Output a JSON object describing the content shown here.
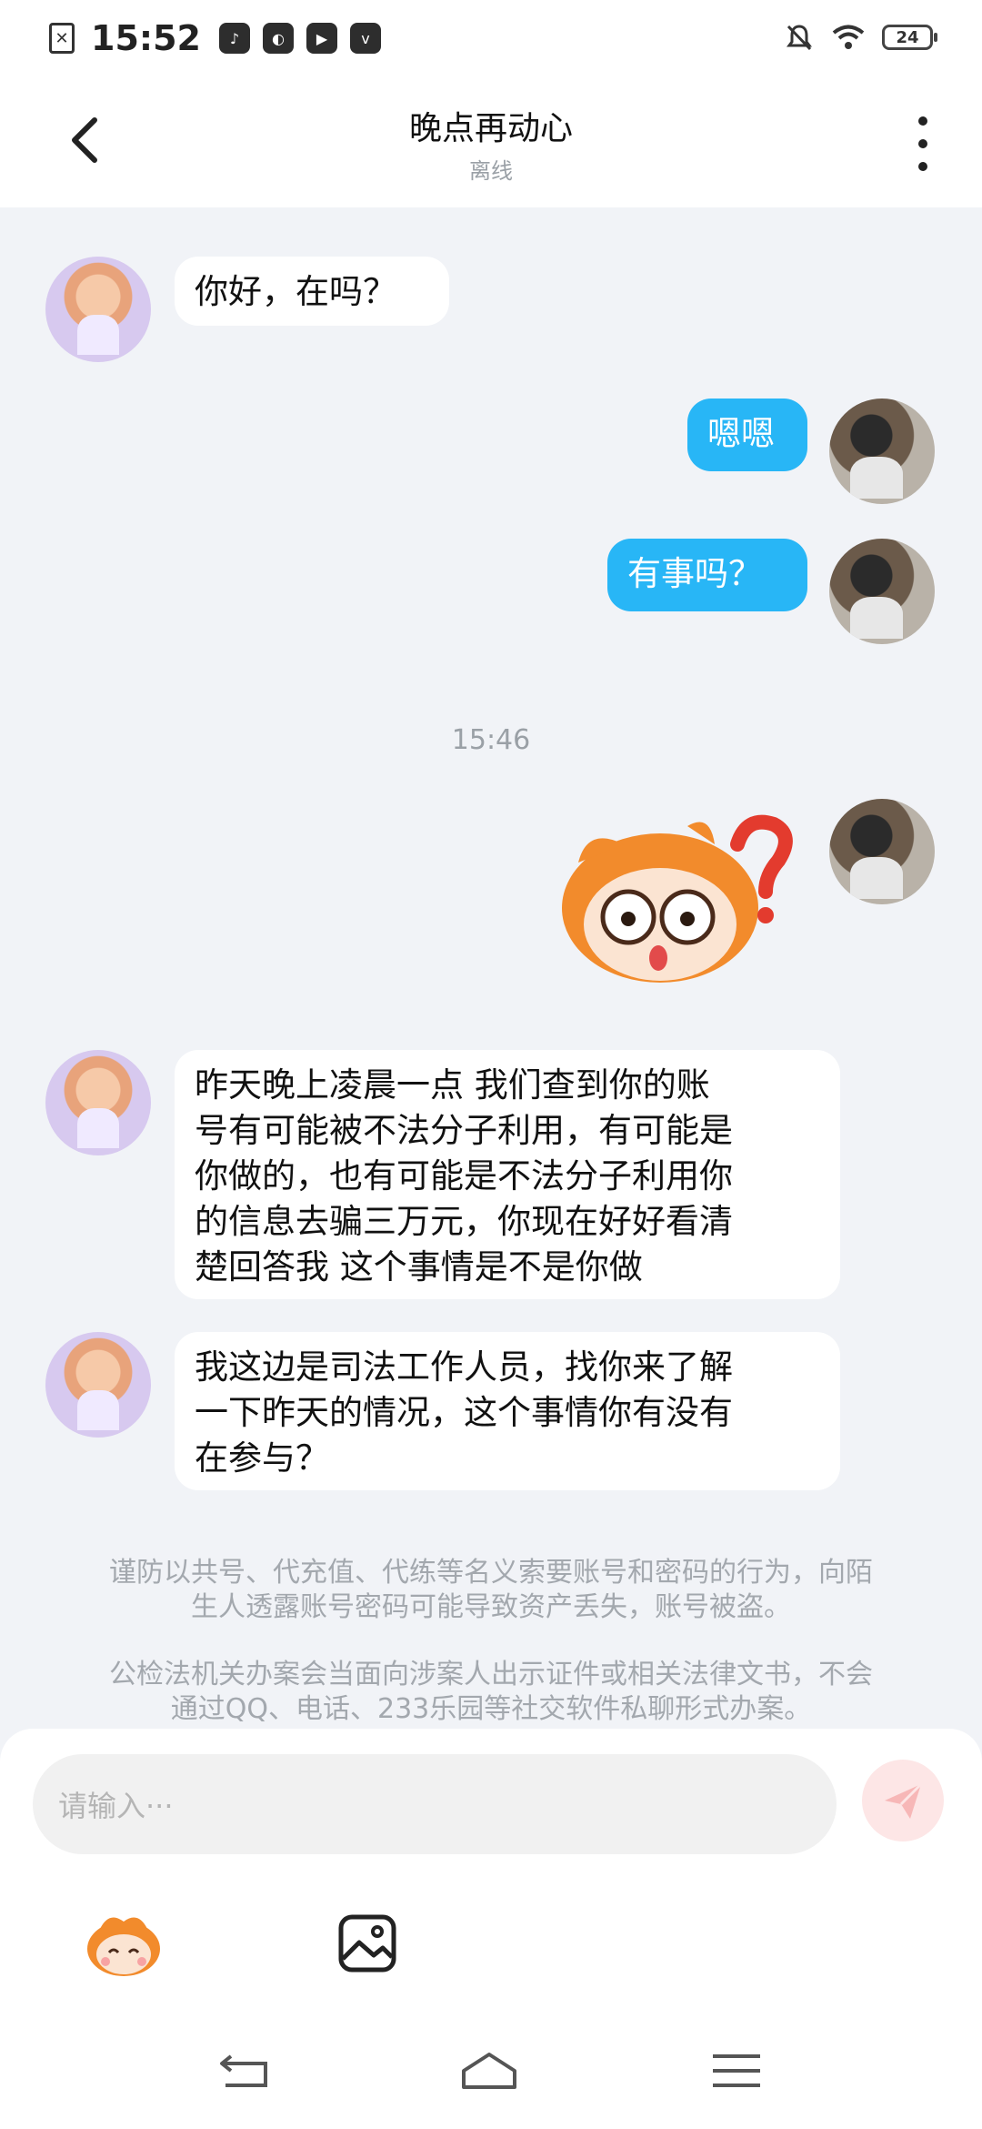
{
  "status_bar": {
    "time": "15:52",
    "battery": "24",
    "icons": [
      "doc-close-icon",
      "music-app-icon",
      "leaf-app-icon",
      "media-play-icon",
      "vivo-app-icon",
      "bell-off-icon",
      "wifi-icon",
      "battery-icon"
    ]
  },
  "header": {
    "title": "晚点再动心",
    "subtitle": "离线"
  },
  "messages": [
    {
      "from": "other",
      "text": "你好，在吗？"
    },
    {
      "from": "me",
      "text": "嗯嗯"
    },
    {
      "from": "me",
      "text": "有事吗？"
    },
    {
      "type": "time",
      "text": "15:46"
    },
    {
      "from": "me",
      "type": "sticker",
      "sticker": "confused-question-mark-sticker"
    },
    {
      "from": "other",
      "lines": [
        "昨天晚上凌晨一点 我们查到你的账",
        "号有可能被不法分子利用，有可能是",
        "你做的，也有可能是不法分子利用你",
        "的信息去骗三万元，你现在好好看清",
        "楚回答我 这个事情是不是你做"
      ]
    },
    {
      "from": "other",
      "lines": [
        "我这边是司法工作人员，找你来了解",
        "一下昨天的情况，这个事情你有没有",
        "在参与？"
      ]
    }
  ],
  "notices": [
    {
      "lines": [
        "谨防以共号、代充值、代练等名义索要账号和密码的行为，向陌",
        "生人透露账号密码可能导致资产丢失，账号被盗。"
      ]
    },
    {
      "lines": [
        "公检法机关办案会当面向涉案人出示证件或相关法律文书，不会",
        "通过QQ、电话、233乐园等社交软件私聊形式办案。"
      ]
    }
  ],
  "input": {
    "placeholder": "请输入···"
  },
  "colors": {
    "my_bubble": "#28b6f6",
    "background": "#f1f3f7",
    "send_button": "#fde6e6"
  }
}
